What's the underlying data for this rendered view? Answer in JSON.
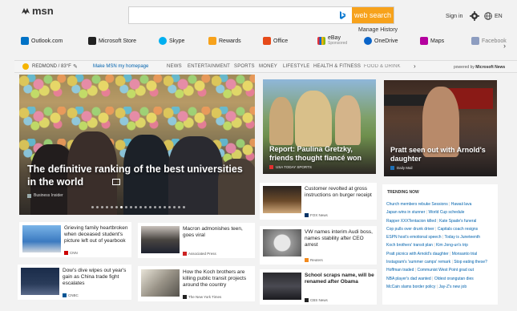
{
  "header": {
    "logo": "msn",
    "search": {
      "value": "",
      "placeholder": "",
      "button": "web search"
    },
    "manage_history": "Manage History",
    "signin": "Sign in",
    "language": "EN"
  },
  "shortcuts": [
    {
      "label": "Outlook.com",
      "color": "#0072c6"
    },
    {
      "label": "Microsoft Store",
      "color": "#222222"
    },
    {
      "label": "Skype",
      "color": "#00aff0"
    },
    {
      "label": "Rewards",
      "color": "#f7a21b"
    },
    {
      "label": "Office",
      "color": "#e64a19"
    },
    {
      "label": "eBay",
      "sub": "Sponsored",
      "color": "#e53238"
    },
    {
      "label": "OneDrive",
      "color": "#0a64c8"
    },
    {
      "label": "Maps",
      "color": "#b4009e"
    },
    {
      "label": "Facebook",
      "color": "#3b5998"
    }
  ],
  "nav": {
    "weather": "REDMOND / 83°F",
    "make_home": "Make MSN my homepage",
    "items": [
      "NEWS",
      "ENTERTAINMENT",
      "SPORTS",
      "MONEY",
      "LIFESTYLE",
      "HEALTH & FITNESS",
      "FOOD & DRINK"
    ],
    "powered_prefix": "powered by",
    "powered_brand": "Microsoft News"
  },
  "hero": {
    "title": "The definitive ranking of the best universities in the world",
    "source": "Business Insider"
  },
  "features": [
    {
      "title": "Report: Paulina Gretzky, friends thought fiancé won",
      "source": "USA TODAY SPORTS",
      "source_color": "#e03030"
    },
    {
      "title": "Pratt seen out with Arnold's daughter",
      "source": "Daily Mail",
      "source_color": "#1f6fb5"
    }
  ],
  "news": [
    {
      "text": "Grieving family heartbroken when deceased student's picture left out of yearbook",
      "source": "CNN",
      "source_color": "#cc0000"
    },
    {
      "text": "Macron admonishes teen, goes viral",
      "source": "Associated Press",
      "source_color": "#cc2222"
    },
    {
      "text": "Customer revolted at gross instructions on burger receipt",
      "source": "FOX News",
      "source_color": "#003366"
    },
    {
      "text": "Dow's dive wipes out year's gain as China trade fight escalates",
      "source": "CNBC",
      "source_color": "#005594"
    },
    {
      "text": "How the Koch brothers are killing public transit projects around the country",
      "source": "The New York Times",
      "source_color": "#222222"
    },
    {
      "text": "VW names interim Audi boss, names stability after CEO arrest",
      "source": "Reuters",
      "source_color": "#f28a1e"
    },
    {
      "text": "School scraps name, will be renamed after Obama",
      "source": "CBS News",
      "source_color": "#222222"
    }
  ],
  "trending": {
    "heading": "TRENDING NOW",
    "items": [
      "Church members rebuke Sessions",
      "Hawaii lava",
      "Japan wins in stunner",
      "World Cup schedule",
      "Rapper XXXTentacion killed",
      "Kate Spade's funeral",
      "Cop pulls over drunk driver",
      "Capitals coach resigns",
      "ESPN host's emotional speech",
      "Today is Juneteenth",
      "Koch brothers' transit plan",
      "Kim Jong-un's trip",
      "Pratt picnics with Arnold's daughter",
      "Monsanto trial",
      "Instagram's 'summer camps' remark",
      "Stop eating these?",
      "Hoffman traded",
      "Communist West Point grad out",
      "NBA player's dad wanted",
      "Oldest orangutan dies",
      "McCain slams border policy",
      "Jay-Z's new job"
    ]
  }
}
